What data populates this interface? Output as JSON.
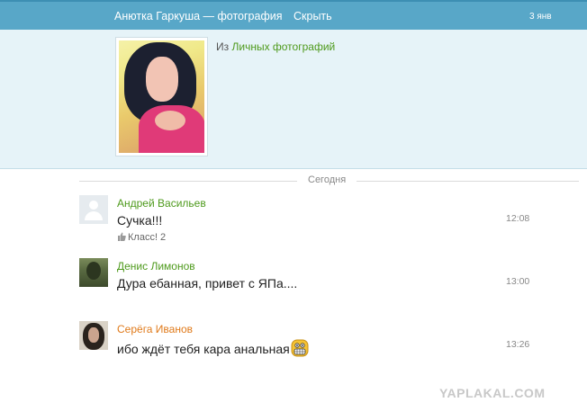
{
  "header": {
    "title": "Анютка Гаркуша — фотография",
    "hide_label": "Скрыть",
    "date": "3 янв"
  },
  "photo": {
    "from_prefix": "Из",
    "album_link": "Личных фотографий"
  },
  "divider": {
    "label": "Сегодня"
  },
  "comments": [
    {
      "author": "Андрей Васильев",
      "author_color": "#4e9a1c",
      "text": "Сучка!!!",
      "time": "12:08",
      "like_label": "Класс! 2",
      "avatar": "default-user-icon"
    },
    {
      "author": "Денис Лимонов",
      "author_color": "#4e9a1c",
      "text": "Дура ебанная, привет с ЯПа....",
      "time": "13:00",
      "avatar": "nature-photo"
    },
    {
      "author": "Серёга Иванов",
      "author_color": "#e07a1a",
      "text": "ибо ждёт тебя кара анальная",
      "time": "13:26",
      "avatar": "portrait-photo",
      "emoji": "grinning-smiley-icon"
    }
  ],
  "watermark": "YAPLAKAL.COM"
}
